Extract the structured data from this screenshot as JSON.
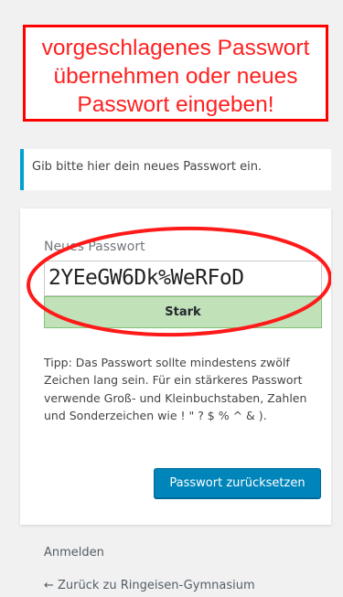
{
  "callout": {
    "line1": "vorgeschlagenes Passwort",
    "line2": "übernehmen oder neues",
    "line3": "Passwort eingeben!"
  },
  "notice": {
    "text": "Gib bitte hier dein neues Passwort ein."
  },
  "form": {
    "password_label": "Neues Passwort",
    "password_value": "2YEeGW6Dk%WeRFoD",
    "strength_label": "Stark",
    "hint": "Tipp: Das Passwort sollte mindestens zwölf Zeichen lang sein. Für ein stärkeres Passwort verwende Groß- und Kleinbuchstaben, Zahlen und Sonderzeichen wie ! \" ? $ % ^ & ).",
    "submit_label": "Passwort zurücksetzen"
  },
  "nav": {
    "login_label": "Anmelden",
    "back_label": "← Zurück zu Ringeisen-Gymnasium"
  },
  "colors": {
    "accent": "#0085ba",
    "notice_border": "#00a0d2",
    "strength_bg": "#c1e1b9",
    "annotation_red": "#ff0000"
  }
}
